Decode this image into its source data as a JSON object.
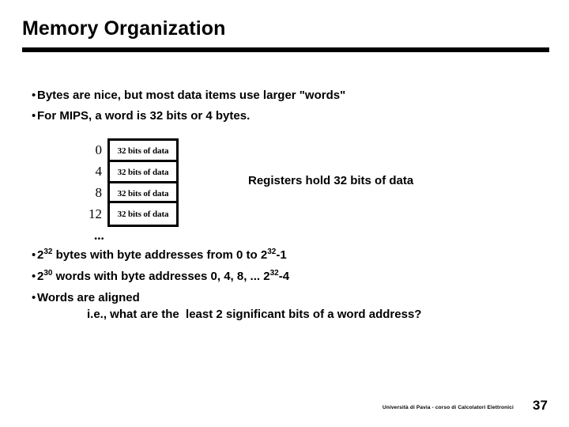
{
  "slide": {
    "title": "Memory Organization",
    "bullets_top": [
      {
        "marker": "•",
        "text": "Bytes are nice, but most data items use larger \"words\""
      },
      {
        "marker": "•",
        "text": "For MIPS, a word is 32 bits or 4 bytes."
      }
    ],
    "memory_diagram": {
      "rows": [
        {
          "address": "0",
          "cell": "32 bits of data"
        },
        {
          "address": "4",
          "cell": "32 bits of data"
        },
        {
          "address": "8",
          "cell": "32 bits of data"
        },
        {
          "address": "12",
          "cell": "32 bits of data"
        }
      ],
      "ellipsis": "..."
    },
    "side_note": "Registers hold 32 bits of data",
    "bullets_bottom": [
      {
        "marker": "•",
        "pre": "2",
        "sup1": "32",
        "mid": " bytes with byte addresses from 0 to 2",
        "sup2": "32",
        "post": "-1"
      },
      {
        "marker": "•",
        "pre": "2",
        "sup1": "30",
        "mid": " words with byte addresses 0, 4, 8, ... 2",
        "sup2": "32",
        "post": "-4"
      },
      {
        "marker": "•",
        "text": "Words are aligned"
      }
    ],
    "subline": "i.e., what are the  least 2 significant bits of a word address?",
    "footer": {
      "credit": "Università di Pavia  - corso di Calcolatori Elettronici",
      "page_number": "37"
    }
  }
}
